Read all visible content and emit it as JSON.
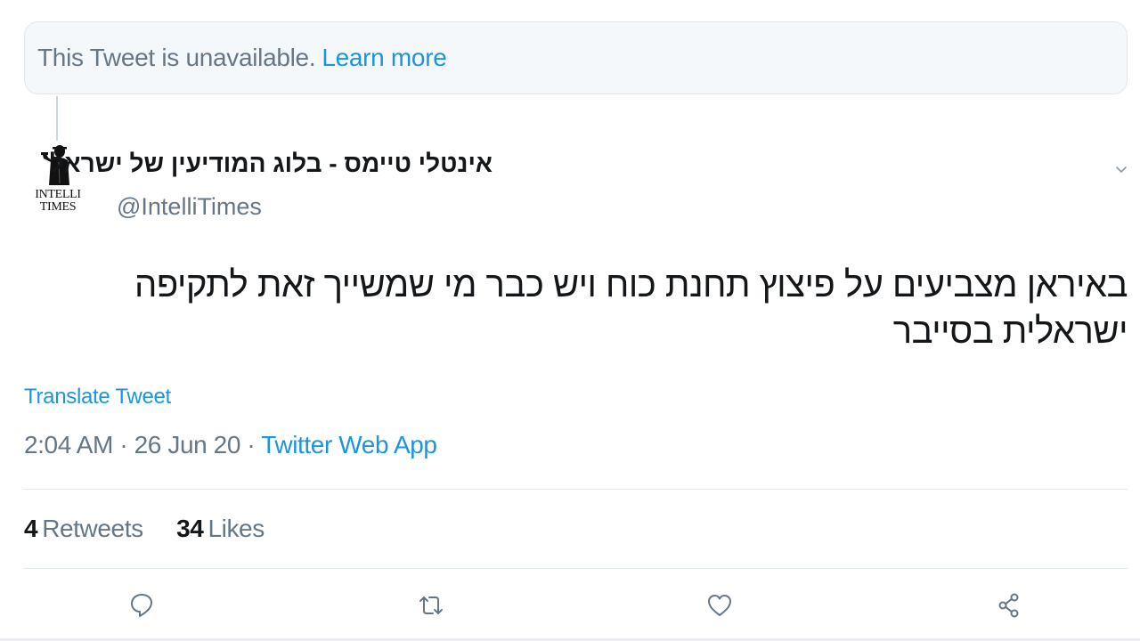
{
  "unavailable_notice": {
    "text": "This Tweet is unavailable.",
    "link_label": "Learn more"
  },
  "author": {
    "display_name": "אינטלי טיימס - בלוג המודיעין של ישראל",
    "handle": "@IntelliTimes",
    "avatar_text_line1": "INTELLI",
    "avatar_text_line2": "TIMES"
  },
  "tweet": {
    "text": "באיראן מצביעים על פיצוץ תחנת כוח ויש כבר מי שמשייך זאת לתקיפה ישראלית בסייבר",
    "translate_label": "Translate Tweet",
    "time": "2:04 AM",
    "separator": " · ",
    "date": "26 Jun 20",
    "source": "Twitter Web App"
  },
  "stats": {
    "retweets_count": "4",
    "retweets_label": "Retweets",
    "likes_count": "34",
    "likes_label": "Likes"
  },
  "actions": [
    {
      "name": "reply",
      "icon": "speech-bubble-icon"
    },
    {
      "name": "retweet",
      "icon": "retweet-icon"
    },
    {
      "name": "like",
      "icon": "heart-icon"
    },
    {
      "name": "share",
      "icon": "share-icon"
    }
  ],
  "colors": {
    "accent": "#1b95e0",
    "secondary_text": "#657786",
    "primary_text": "#14171a",
    "border": "#e1e8ed",
    "notice_background": "#f5f8fa"
  }
}
